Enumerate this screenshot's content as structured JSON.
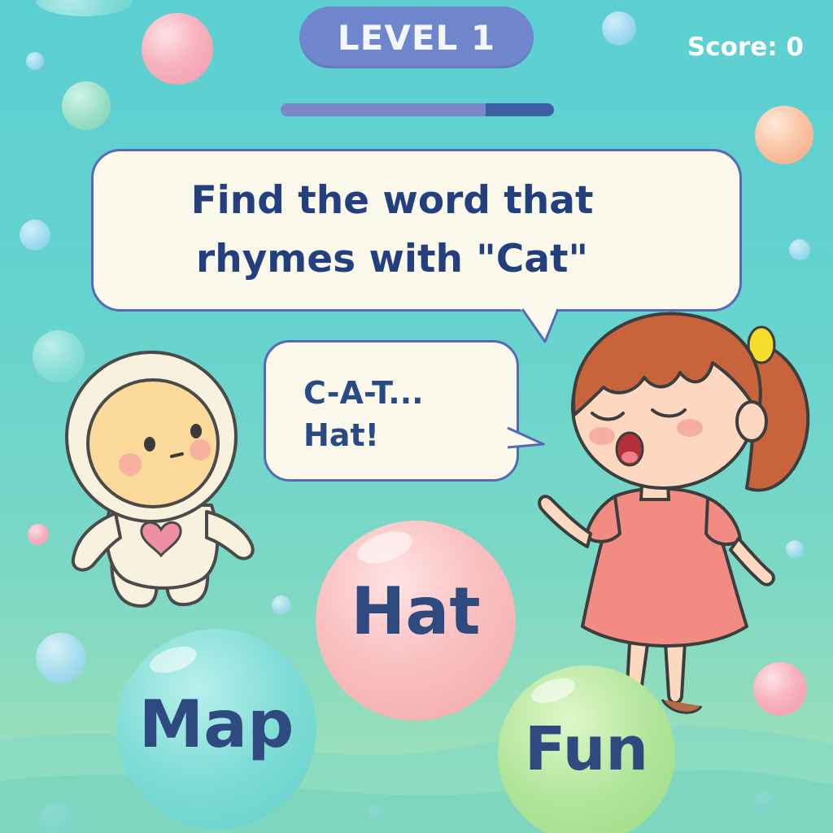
{
  "hud": {
    "level_label": "LEVEL 1",
    "score_label": "Score: 0",
    "progress": 0.75
  },
  "prompt": {
    "question": "Find the word that\nrhymes with \"Cat\"",
    "answer_speech": "C-A-T...\nHat!"
  },
  "choices": [
    {
      "word": "Hat",
      "color": "#f6b6b6"
    },
    {
      "word": "Map",
      "color": "#74d6d0"
    },
    {
      "word": "Fun",
      "color": "#a7e08f"
    }
  ],
  "characters": {
    "robot": "astronaut-buddy",
    "girl": "child-player"
  },
  "colors": {
    "accent": "#6f86cd",
    "text": "#2f4a7e",
    "background": "#5ccfd2"
  }
}
